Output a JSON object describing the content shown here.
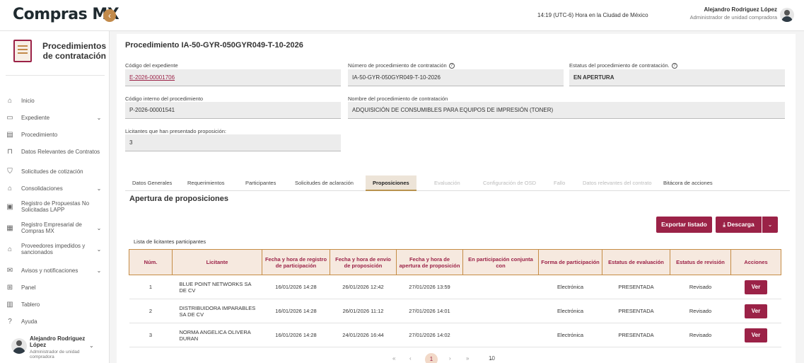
{
  "header": {
    "logo": "Compras MX",
    "timezone": "14:19 (UTC-6) Hora en la Ciudad de México",
    "user_name": "Alejandro Rodriguez López",
    "user_role": "Administrador de unidad compradora"
  },
  "sidebar": {
    "title": "Procedimientos de contratación",
    "items": [
      {
        "label": "Inicio",
        "icon": "home-icon",
        "glyph": "⌂",
        "chevron": ""
      },
      {
        "label": "Expediente",
        "icon": "folder-icon",
        "glyph": "▭",
        "chevron": "⌄"
      },
      {
        "label": "Procedimiento",
        "icon": "document-icon",
        "glyph": "▤",
        "chevron": ""
      },
      {
        "label": "Datos Relevantes de Contratos",
        "icon": "bookmark-icon",
        "glyph": "⊓",
        "chevron": ""
      },
      {
        "label": "Solicitudes de cotización",
        "icon": "cart-icon",
        "glyph": "⛉",
        "chevron": ""
      },
      {
        "label": "Consolidaciones",
        "icon": "building-icon",
        "glyph": "⌂",
        "chevron": "⌄"
      },
      {
        "label": "Registro de Propuestas No Solicitadas LAPP",
        "icon": "register-icon",
        "glyph": "▣",
        "chevron": ""
      },
      {
        "label": "Registro Empresarial de Compras MX",
        "icon": "id-card-icon",
        "glyph": "▦",
        "chevron": "⌄"
      },
      {
        "label": "Proveedores impedidos y sancionados",
        "icon": "bank-icon",
        "glyph": "⌂",
        "chevron": "⌄"
      },
      {
        "label": "Avisos y notificaciones",
        "icon": "mail-icon",
        "glyph": "✉",
        "chevron": "⌄"
      },
      {
        "label": "Panel",
        "icon": "grid-icon",
        "glyph": "⊞",
        "chevron": ""
      },
      {
        "label": "Tablero",
        "icon": "bar-chart-icon",
        "glyph": "▥",
        "chevron": ""
      },
      {
        "label": "Ayuda",
        "icon": "help-icon",
        "glyph": "?",
        "chevron": ""
      }
    ],
    "footer_name": "Alejandro Rodriguez López",
    "footer_role": "Administrador de unidad compradora"
  },
  "procedure": {
    "title": "Procedimiento IA-50-GYR-050GYR049-T-10-2026",
    "fields": {
      "codigo_expediente_label": "Código del expediente",
      "codigo_expediente": "E-2026-00001706",
      "numero_label": "Número de procedimiento de contratación",
      "numero": "IA-50-GYR-050GYR049-T-10-2026",
      "estatus_label": "Estatus del procedimiento de contratación.",
      "estatus": "EN APERTURA",
      "codigo_interno_label": "Código interno del procedimiento",
      "codigo_interno": "P-2026-00001541",
      "nombre_label": "Nombre del procedimiento de contratación",
      "nombre": "ADQUISICIÓN DE  CONSUMIBLES PARA EQUIPOS DE IMPRESIÓN (TONER)",
      "licitantes_label": "Licitantes que han presentado proposición:",
      "licitantes": "3"
    }
  },
  "tabs": [
    {
      "label": "Datos Generales",
      "state": "normal"
    },
    {
      "label": "Requerimientos",
      "state": "normal"
    },
    {
      "label": "Participantes",
      "state": "normal"
    },
    {
      "label": "Solicitudes de aclaración",
      "state": "normal"
    },
    {
      "label": "Proposiciones",
      "state": "active"
    },
    {
      "label": "Evaluación",
      "state": "disabled"
    },
    {
      "label": "Configuración de OSD",
      "state": "disabled"
    },
    {
      "label": "Fallo",
      "state": "disabled"
    },
    {
      "label": "Datos relevantes del contrato",
      "state": "disabled"
    },
    {
      "label": "Bitácora de acciones",
      "state": "normal"
    }
  ],
  "section": {
    "title": "Apertura de proposiciones",
    "export_label": "Exportar listado",
    "download_label": "Descarga",
    "list_label": "Lista de licitantes participantes"
  },
  "table": {
    "columns": [
      "Núm.",
      "Licitante",
      "Fecha y hora de registro de participación",
      "Fecha y hora de envío de proposición",
      "Fecha y hora de apertura de proposición",
      "En participación conjunta con",
      "Forma de participación",
      "Estatus de evaluación",
      "Estatus de revisión",
      "Acciones"
    ],
    "rows": [
      [
        "1",
        "BLUE POINT NETWORKS SA DE CV",
        "16/01/2026 14:28",
        "26/01/2026 12:42",
        "27/01/2026 13:59",
        "",
        "Electrónica",
        "PRESENTADA",
        "Revisado",
        "Ver"
      ],
      [
        "2",
        "DISTRIBUIDORA IMPARABLES SA DE CV",
        "16/01/2026 14:28",
        "26/01/2026 11:12",
        "27/01/2026 14:01",
        "",
        "Electrónica",
        "PRESENTADA",
        "Revisado",
        "Ver"
      ],
      [
        "3",
        "NORMA ANGELICA OLIVERA DURAN",
        "16/01/2026 14:28",
        "24/01/2026 16:44",
        "27/01/2026 14:02",
        "",
        "Electrónica",
        "PRESENTADA",
        "Revisado",
        "Ver"
      ]
    ]
  },
  "pagination": {
    "first": "«",
    "prev": "‹",
    "current": "1",
    "next": "›",
    "last": "»",
    "page_size": "10"
  },
  "colors": {
    "brand": "#9b2247",
    "accent": "#c28a4a",
    "header_bg": "#f6e9df"
  }
}
